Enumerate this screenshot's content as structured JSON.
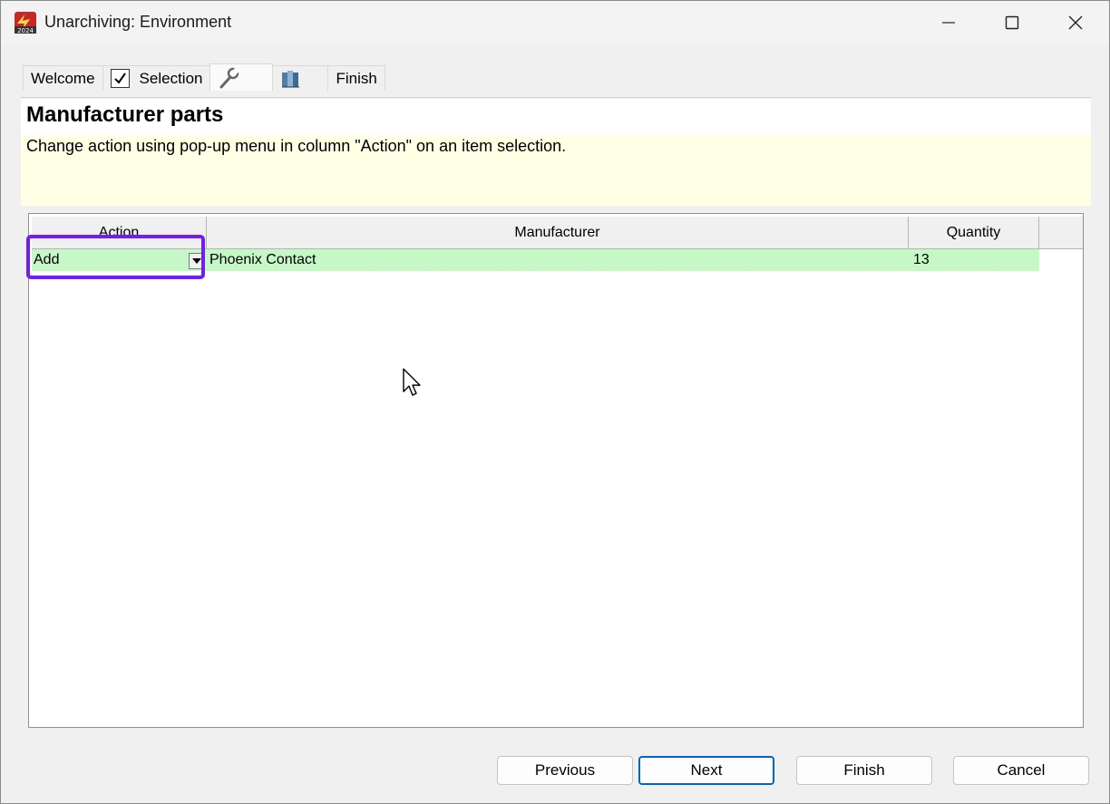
{
  "window": {
    "title": "Unarchiving: Environment"
  },
  "tabs": [
    {
      "label": "Welcome"
    },
    {
      "label": "Selection",
      "checked": true
    },
    {
      "label": "",
      "icon": "wrench-icon"
    },
    {
      "label": "",
      "icon": "books-icon"
    },
    {
      "label": "Finish"
    }
  ],
  "page": {
    "title": "Manufacturer parts",
    "hint": "Change action using pop-up menu in column \"Action\" on an item selection."
  },
  "grid": {
    "columns": [
      "Action",
      "Manufacturer",
      "Quantity"
    ],
    "rows": [
      {
        "action": "Add",
        "manufacturer": "Phoenix Contact",
        "quantity": "13"
      }
    ]
  },
  "buttons": {
    "previous": "Previous",
    "next": "Next",
    "finish": "Finish",
    "cancel": "Cancel"
  },
  "colors": {
    "row_highlight": "#c6f7c6",
    "info_box": "#ffffe6",
    "annotation": "#6f1cf5"
  }
}
